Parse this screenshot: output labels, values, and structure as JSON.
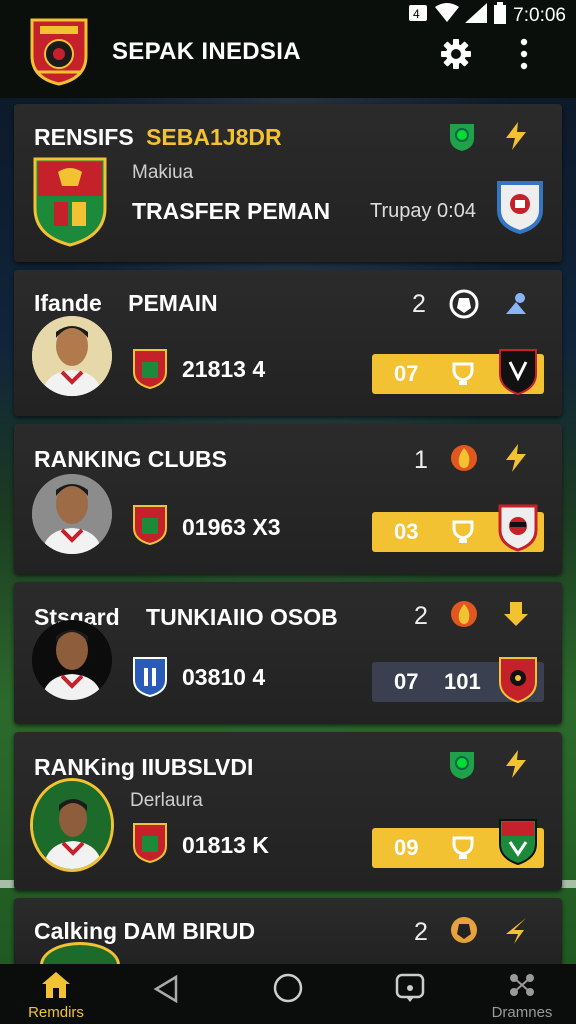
{
  "status": {
    "time": "7:0:06"
  },
  "app": {
    "title": "SEPAK INEDSIA"
  },
  "cards": [
    {
      "title_a": "RENSIFS",
      "title_b": "SEBA1J8DR",
      "sub": "Makiua",
      "main": "TRASFER PEMAN",
      "meta": "Trupay 0:04"
    },
    {
      "title_a": "Ifande",
      "title_b": "PEMAIN",
      "num": "2",
      "stat": "21813  4",
      "pill": "07"
    },
    {
      "title_a": "RANKING CLUBS",
      "num": "1",
      "stat": "01963  X3",
      "pill": "03"
    },
    {
      "title_a": "Stsgard",
      "title_b": "TUNKIAIIO OSOB",
      "num": "2",
      "stat": "03810  4",
      "pill": "07",
      "pill2": "101"
    },
    {
      "title_a": "RANKing IIUBSLVDI",
      "sub": "Derlaura",
      "stat": "01813  K",
      "pill": "09"
    },
    {
      "title_a": "Calking DAM BIRUD",
      "num": "2"
    }
  ],
  "nav": {
    "left_label": "Remdirs",
    "right_label": "Dramnes"
  },
  "colors": {
    "accent_yellow": "#f2c232",
    "card_bg": "#262626",
    "green_icon": "#1fa24a",
    "orange_icon": "#e2561f"
  }
}
